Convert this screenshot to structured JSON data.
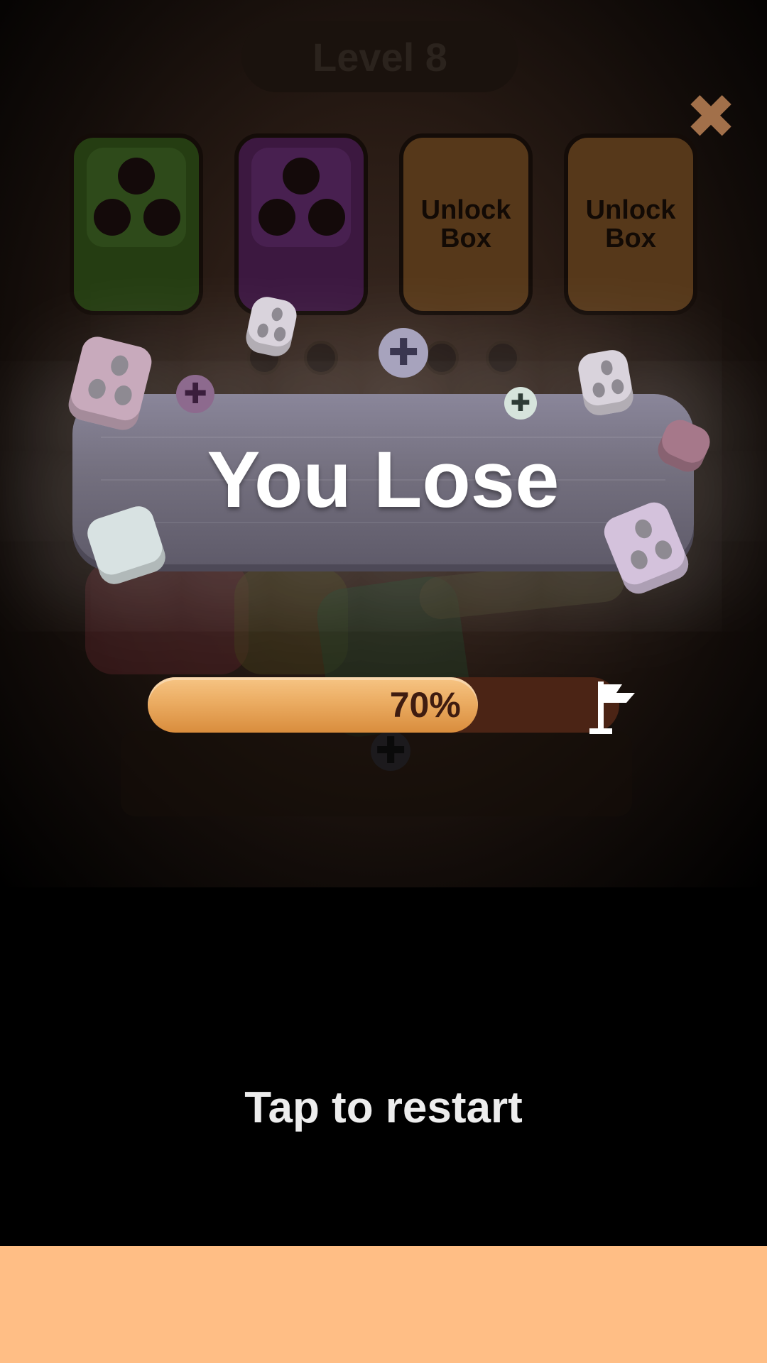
{
  "header": {
    "level_label": "Level 8"
  },
  "boxes": [
    {
      "type": "color",
      "color": "#253d12"
    },
    {
      "type": "color",
      "color": "#3c1840"
    },
    {
      "type": "locked",
      "label": "Unlock\nBox"
    },
    {
      "type": "locked",
      "label": "Unlock\nBox"
    }
  ],
  "panel": {
    "title": "You Lose"
  },
  "progress": {
    "percent": 70,
    "label": "70%"
  },
  "footer": {
    "restart_label": "Tap to restart"
  },
  "icons": {
    "close": "close-icon",
    "flag": "flag-icon"
  },
  "colors": {
    "progress_fill": "#ebac62",
    "progress_track": "#4b2415",
    "banner": "#ffbe85",
    "close": "#a2704a"
  }
}
